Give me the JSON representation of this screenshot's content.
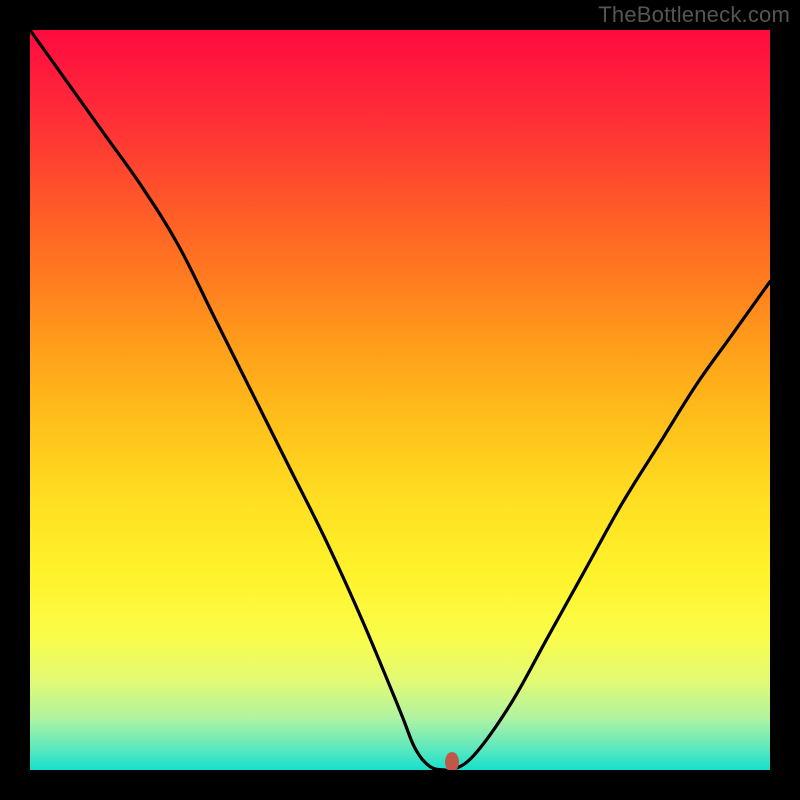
{
  "watermark": "TheBottleneck.com",
  "colors": {
    "frame": "#000000",
    "curve": "#000000",
    "marker": "#c0584a",
    "gradient_top": "#ff0b3f",
    "gradient_bottom": "#16e0cf"
  },
  "chart_data": {
    "type": "line",
    "title": "",
    "xlabel": "",
    "ylabel": "",
    "xlim": [
      0,
      100
    ],
    "ylim": [
      0,
      100
    ],
    "grid": false,
    "legend": false,
    "note": "Values read from the curve at 5% x-intervals; y=0 at bottom, y=100 at top.",
    "series": [
      {
        "name": "bottleneck-curve",
        "x": [
          0,
          5,
          10,
          15,
          20,
          25,
          30,
          35,
          40,
          45,
          50,
          52,
          54,
          56,
          57,
          60,
          65,
          70,
          75,
          80,
          85,
          90,
          95,
          100
        ],
        "y": [
          100,
          93,
          86,
          79,
          71,
          61,
          51,
          41,
          31,
          20,
          8,
          3,
          0.5,
          0,
          0,
          2,
          9,
          18,
          27,
          36,
          44,
          52,
          59,
          66
        ]
      }
    ],
    "marker": {
      "x": 57,
      "y": 0
    },
    "background_gradient": {
      "orientation": "vertical",
      "stops": [
        {
          "pos": 0.0,
          "color": "#ff0b3f"
        },
        {
          "pos": 0.24,
          "color": "#ff5a28"
        },
        {
          "pos": 0.54,
          "color": "#ffc31b"
        },
        {
          "pos": 0.82,
          "color": "#fafc4a"
        },
        {
          "pos": 1.0,
          "color": "#16e0cf"
        }
      ]
    }
  }
}
